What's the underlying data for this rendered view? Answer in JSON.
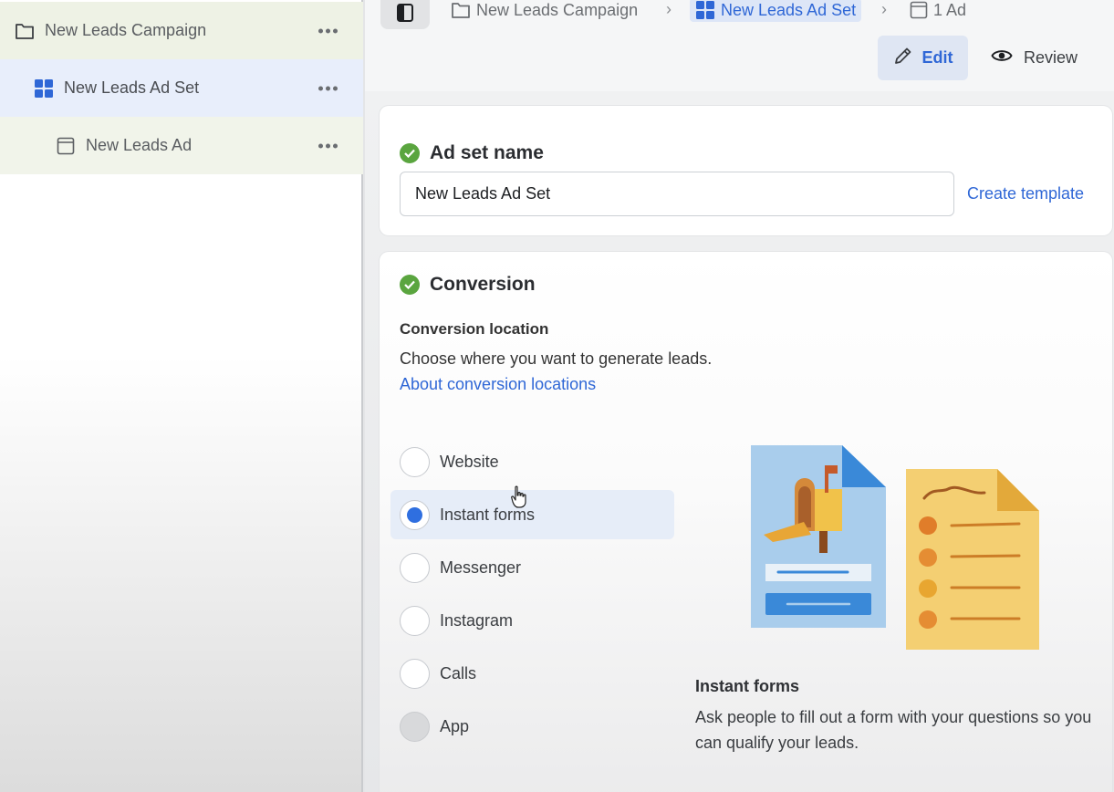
{
  "sidebar": {
    "items": [
      {
        "label": "New Leads Campaign",
        "icon": "folder-icon"
      },
      {
        "label": "New Leads Ad Set",
        "icon": "grid-icon"
      },
      {
        "label": "New Leads Ad",
        "icon": "ad-icon"
      }
    ]
  },
  "breadcrumb": {
    "campaign": "New Leads Campaign",
    "adset": "New Leads Ad Set",
    "ad": "1 Ad"
  },
  "toolbar": {
    "edit_label": "Edit",
    "review_label": "Review"
  },
  "adset_name_card": {
    "title": "Ad set name",
    "input_value": "New Leads Ad Set",
    "create_template": "Create template"
  },
  "conversion_card": {
    "title": "Conversion",
    "location_heading": "Conversion location",
    "description": "Choose where you want to generate leads.",
    "link": "About conversion locations",
    "options": [
      {
        "label": "Website",
        "selected": false
      },
      {
        "label": "Instant forms",
        "selected": true
      },
      {
        "label": "Messenger",
        "selected": false
      },
      {
        "label": "Instagram",
        "selected": false
      },
      {
        "label": "Calls",
        "selected": false
      },
      {
        "label": "App",
        "selected": false,
        "disabled": true
      }
    ],
    "info_title": "Instant forms",
    "info_description": "Ask people to fill out a form with your questions so you can qualify your leads."
  },
  "colors": {
    "accent": "#2f67d6",
    "success": "#5aa53f"
  }
}
